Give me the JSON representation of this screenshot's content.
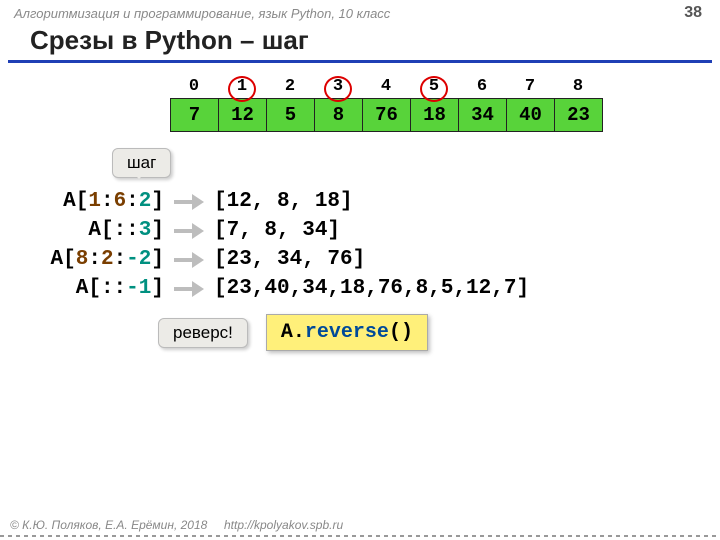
{
  "header": "Алгоритмизация и программирование, язык Python, 10 класс",
  "page": "38",
  "title": "Срезы в Python – шаг",
  "indices": [
    "0",
    "1",
    "2",
    "3",
    "4",
    "5",
    "6",
    "7",
    "8"
  ],
  "circled": [
    1,
    3,
    5
  ],
  "cells": [
    "7",
    "12",
    "5",
    "8",
    "76",
    "18",
    "34",
    "40",
    "23"
  ],
  "bubble_step": "шаг",
  "lines": {
    "l1": {
      "pre": "A[",
      "a": "1",
      "b": "6",
      "c": "2",
      "post": "]",
      "rhs": "[12, 8, 18]"
    },
    "l2": {
      "pre": "A[::",
      "c": "3",
      "post": "]",
      "rhs": "[7, 8, 34]"
    },
    "l3": {
      "pre": "A[",
      "a": "8",
      "b": "2",
      "c": "-2",
      "post": "]",
      "rhs": "[23, 34, 76]"
    },
    "l4": {
      "pre": "A[::",
      "c": "-1",
      "post": "]",
      "rhs": "[23,40,34,18,76,8,5,12,7]"
    }
  },
  "bubble_rev": "реверс!",
  "code": {
    "a": "A",
    "dot": ".",
    "fn": "reverse",
    "par": "()"
  },
  "footer": {
    "left": "© К.Ю. Поляков, Е.А. Ерёмин, 2018",
    "right": "http://kpolyakov.spb.ru"
  }
}
